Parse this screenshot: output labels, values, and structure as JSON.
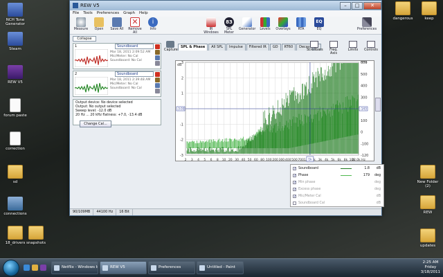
{
  "desktop": {
    "left_icons": [
      {
        "label": "NCH Tone Generator",
        "kind": "app-blue"
      },
      {
        "label": "Steam",
        "kind": "app-blue"
      },
      {
        "label": "REW V5",
        "kind": "app-rew"
      },
      {
        "label": "forum paste",
        "kind": "doc"
      },
      {
        "label": "correction",
        "kind": "doc"
      },
      {
        "label": "sd",
        "kind": "folder"
      },
      {
        "label": "connections",
        "kind": "app-net"
      },
      {
        "label": "18_drivers",
        "kind": "folder"
      },
      {
        "label": "snapshots",
        "kind": "folder"
      }
    ],
    "right_icons": [
      {
        "label": "dangerous",
        "kind": "folder"
      },
      {
        "label": "keep",
        "kind": "folder"
      },
      {
        "label": "New Folder (2)",
        "kind": "folder"
      },
      {
        "label": "REW",
        "kind": "folder"
      },
      {
        "label": "updates",
        "kind": "folder"
      }
    ]
  },
  "window": {
    "title": "REW V5",
    "menu": [
      "File",
      "Tools",
      "Preferences",
      "Graph",
      "Help"
    ],
    "toolbar_left": [
      "Measure",
      "Open",
      "Save All",
      "Remove All",
      "Info"
    ],
    "toolbar_right": [
      "IR Windows",
      "SPL Meter",
      "Generator",
      "Levels",
      "Overlays",
      "RTA",
      "EQ"
    ],
    "spl_value": "83",
    "preferences_label": "Preferences"
  },
  "left_panel": {
    "collapse_label": "Collapse",
    "measurements": [
      {
        "num": "1",
        "name": "Soundboard",
        "date": "Mar 18, 2011 2:09:52 AM",
        "mic": "Mic/Meter: No Cal",
        "sb": "Soundboard: No Cal"
      },
      {
        "num": "2",
        "name": "Soundboard",
        "date": "Mar 18, 2011 2:39:48 AM",
        "mic": "Mic/Meter: No Cal",
        "sb": "Soundboard: No Cal"
      }
    ],
    "info_lines": [
      "Output device: No device selected",
      "Output: No output selected",
      "Sweep level: -12.0 dB",
      "20 Hz ... 20 kHz flatness: +7.0, -13.4 dB"
    ],
    "change_cal": "Change Cal..."
  },
  "graph_header": {
    "capture": "Capture",
    "tabs": [
      "SPL & Phase",
      "All SPL",
      "Impulse",
      "Filtered IR",
      "GD",
      "RT60",
      "Decay",
      "»"
    ],
    "right_tools": [
      "Scrollbars",
      "Freq. Axis",
      "Limits",
      "Controls"
    ]
  },
  "chart_data": {
    "type": "line",
    "ylabel": "dB",
    "y2label": "deg",
    "x_ticks": [
      "2",
      "3",
      "4",
      "5",
      "6",
      "8",
      "10",
      "20",
      "30",
      "40",
      "50",
      "60",
      "80",
      "100",
      "200",
      "300",
      "400",
      "500",
      "700",
      "1.0k",
      "2k",
      "3k",
      "4k",
      "5k",
      "6k",
      "8k",
      "10k",
      "22.0k Hz"
    ],
    "y_ticks": [
      "3",
      "2",
      "1",
      "0",
      "-1",
      "-2",
      "-3"
    ],
    "y_highlight": "-3.03",
    "y2_ticks": [
      "600",
      "500",
      "400",
      "300",
      "200",
      "100",
      "0",
      "-100",
      "-120"
    ],
    "y2_highlight": "-143",
    "cursor_label": "1k",
    "series": [
      {
        "name": "Soundboard",
        "color": "#1f7a1f"
      },
      {
        "name": "Phase",
        "color": "#4fb84f"
      }
    ]
  },
  "legend": [
    {
      "name": "Soundboard",
      "value": "1.8",
      "unit": "dB",
      "checked": true,
      "dim": false
    },
    {
      "name": "Phase",
      "value": "179",
      "unit": "deg",
      "checked": true,
      "dim": false
    },
    {
      "name": "Min phase",
      "value": "",
      "unit": "deg",
      "checked": true,
      "dim": true
    },
    {
      "name": "Excess phase",
      "value": "",
      "unit": "deg",
      "checked": true,
      "dim": true
    },
    {
      "name": "Mic/Meter Cal",
      "value": "",
      "unit": "dB",
      "checked": true,
      "dim": true
    },
    {
      "name": "Soundboard Cal",
      "value": "",
      "unit": "dB",
      "checked": false,
      "dim": true
    }
  ],
  "statusbar": [
    "90/109MB",
    "44100 Hz",
    "16 Bit"
  ],
  "taskbar": {
    "tasks": [
      "Netflix - Windows In...",
      "REW V5",
      "Preferences",
      "Untitled - Paint"
    ],
    "clock_time": "2:25 AM",
    "clock_day": "Friday",
    "clock_date": "3/18/2011"
  }
}
